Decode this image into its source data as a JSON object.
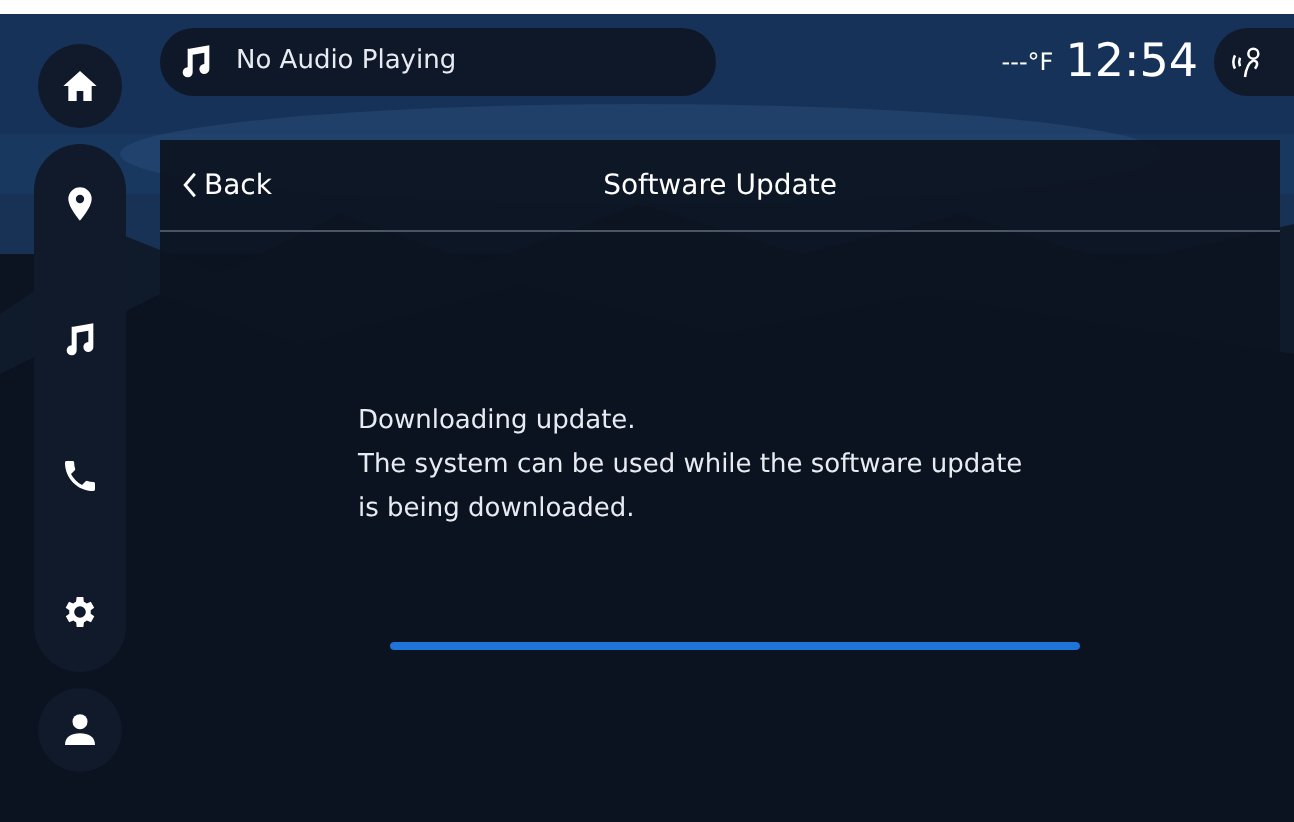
{
  "media": {
    "text": "No Audio Playing"
  },
  "status": {
    "temperature": "---°F",
    "time": "12:54"
  },
  "header": {
    "back": "Back",
    "title": "Software Update"
  },
  "message": {
    "lines": [
      "Downloading update.",
      "The system can be used while the software update",
      "is being downloaded."
    ]
  },
  "progress": {
    "level": 1
  }
}
